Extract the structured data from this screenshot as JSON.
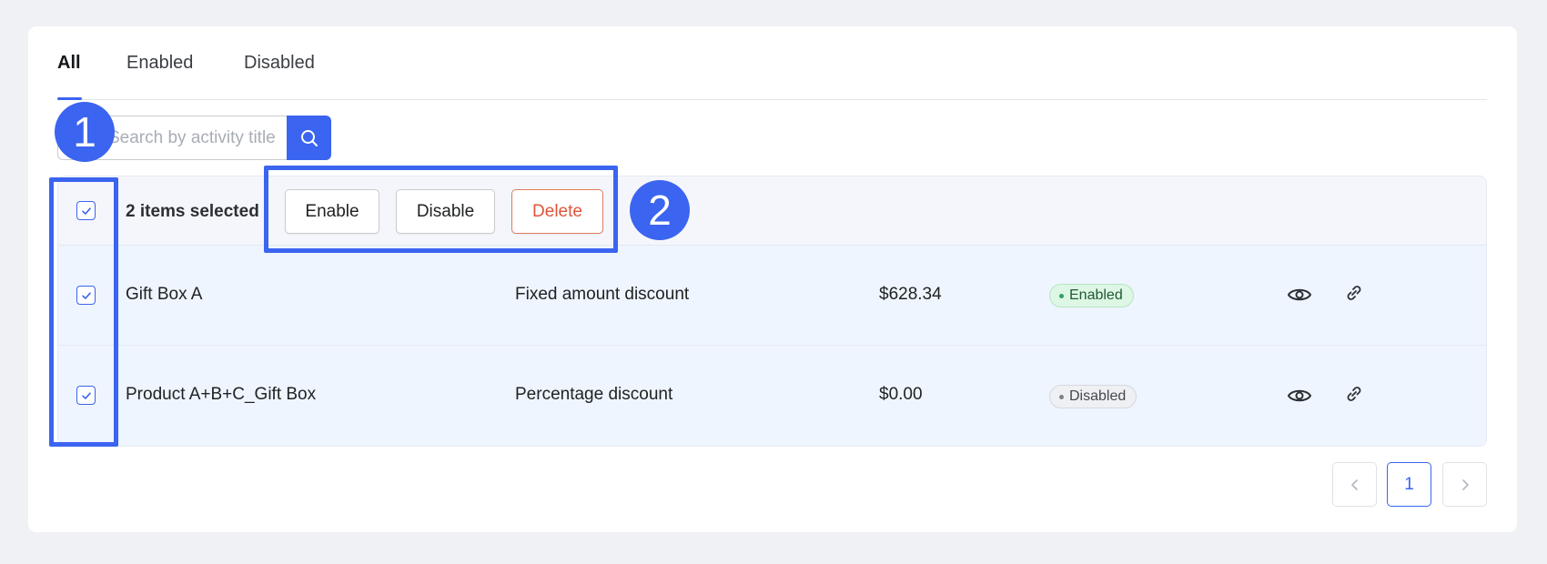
{
  "tabs": [
    {
      "label": "All",
      "active": true
    },
    {
      "label": "Enabled",
      "active": false
    },
    {
      "label": "Disabled",
      "active": false
    }
  ],
  "search": {
    "placeholder": "Search by activity title",
    "value": ""
  },
  "bulk": {
    "selected_text": "2 items selected",
    "enable_label": "Enable",
    "disable_label": "Disable",
    "delete_label": "Delete"
  },
  "rows": [
    {
      "title": "Gift Box A",
      "type": "Fixed amount discount",
      "amount": "$628.34",
      "status": "Enabled",
      "checked": true
    },
    {
      "title": "Product A+B+C_Gift Box",
      "type": "Percentage discount",
      "amount": "$0.00",
      "status": "Disabled",
      "checked": true
    }
  ],
  "pagination": {
    "current_page": "1"
  },
  "annotations": {
    "marker1": "1",
    "marker2": "2"
  },
  "colors": {
    "accent": "#3b64f0",
    "danger": "#e0553a",
    "enabled_badge": "#def7e5",
    "disabled_badge": "#eef0f3"
  }
}
